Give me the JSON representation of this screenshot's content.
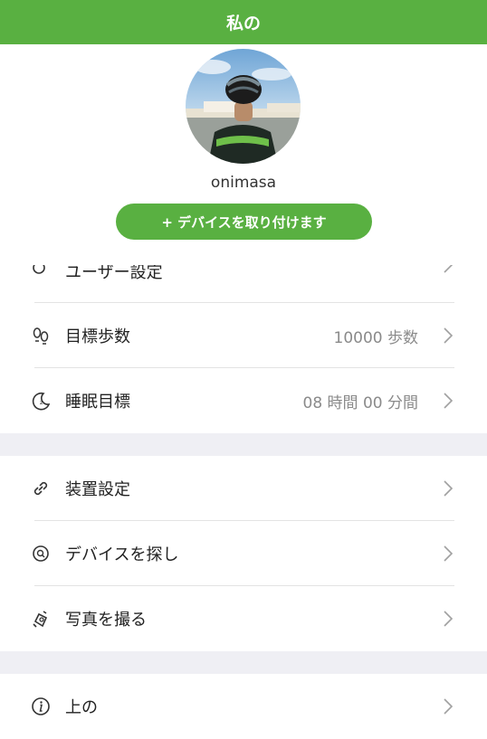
{
  "header": {
    "title": "私の"
  },
  "profile": {
    "username": "onimasa",
    "attach_button": "+ デバイスを取り付けます"
  },
  "partial_row": {
    "label": "ユーザー設定"
  },
  "goals": [
    {
      "label": "目標歩数",
      "value": "10000 歩数",
      "icon": "footprints-icon"
    },
    {
      "label": "睡眠目標",
      "value": "08 時間 00 分間",
      "icon": "moon-sleep-icon"
    }
  ],
  "device": [
    {
      "label": "装置設定",
      "icon": "link-icon"
    },
    {
      "label": "デバイスを探し",
      "icon": "find-device-icon"
    },
    {
      "label": "写真を撮る",
      "icon": "hand-camera-icon"
    }
  ],
  "about": {
    "label": "上の",
    "icon": "info-icon"
  },
  "colors": {
    "accent": "#59b041",
    "section_gap": "#efeff4"
  }
}
